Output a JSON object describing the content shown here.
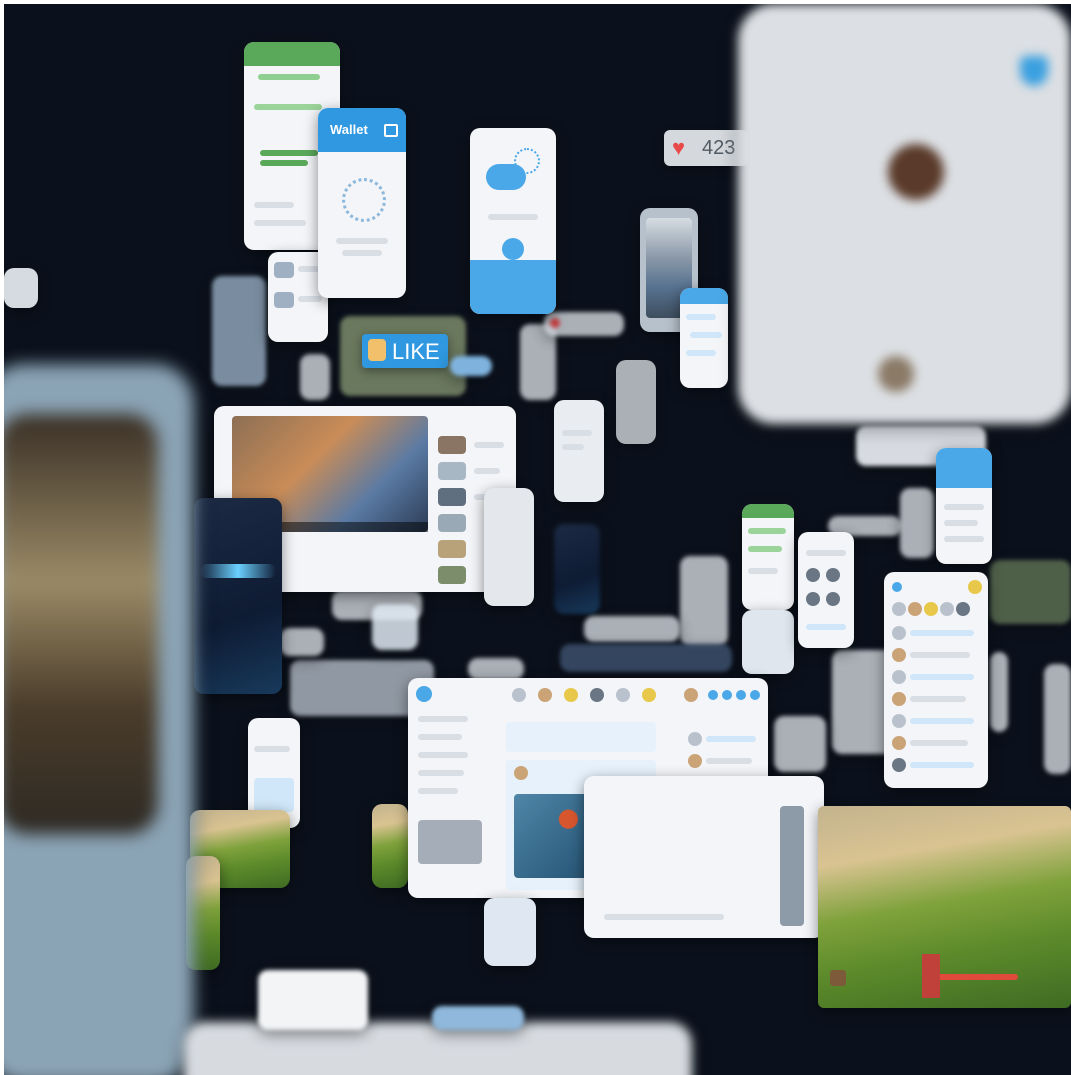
{
  "wallet_card": {
    "title": "Wallet",
    "title_icon": "wallet-icon"
  },
  "like_badge": {
    "label": "LIKE",
    "icon": "thumbs-up-icon"
  },
  "heart_counter": {
    "count": "423",
    "icon": "heart-icon"
  },
  "colors": {
    "background": "#0b111c",
    "card": "#f3f5f8",
    "accent_blue": "#4aa8e8",
    "chat_green": "#5aa85a",
    "heart_red": "#e84a4a"
  }
}
